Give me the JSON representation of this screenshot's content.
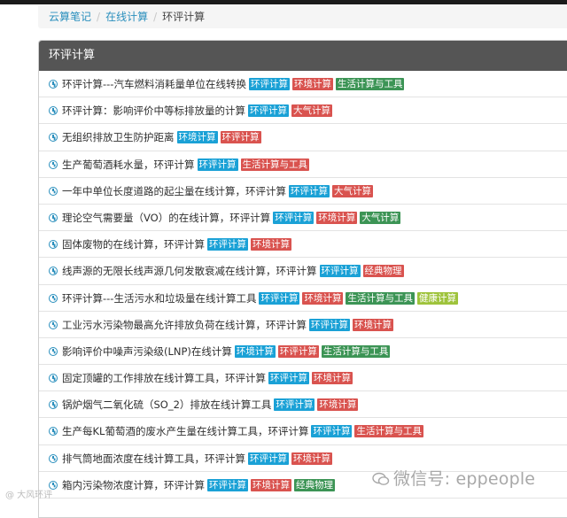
{
  "breadcrumb": {
    "items": [
      "云算笔记",
      "在线计算",
      "环评计算"
    ]
  },
  "panel": {
    "title": "环评计算"
  },
  "tag_colors": {
    "blue": "#1aa1d6",
    "red": "#d9534f",
    "green": "#3c9455",
    "lime": "#9ec33b"
  },
  "items": [
    {
      "title": "环评计算---汽车燃料消耗量单位在线转换",
      "tags": [
        {
          "label": "环评计算",
          "color": "blue"
        },
        {
          "label": "环境计算",
          "color": "red"
        },
        {
          "label": "生活计算与工具",
          "color": "green"
        }
      ]
    },
    {
      "title": "环评计算：影响评价中等标排放量的计算",
      "tags": [
        {
          "label": "环评计算",
          "color": "blue"
        },
        {
          "label": "大气计算",
          "color": "red"
        }
      ]
    },
    {
      "title": "无组织排放卫生防护距离",
      "tags": [
        {
          "label": "环境计算",
          "color": "blue"
        },
        {
          "label": "环评计算",
          "color": "red"
        }
      ]
    },
    {
      "title": "生产葡萄酒耗水量，环评计算",
      "tags": [
        {
          "label": "环评计算",
          "color": "blue"
        },
        {
          "label": "生活计算与工具",
          "color": "red"
        }
      ]
    },
    {
      "title": "一年中单位长度道路的起尘量在线计算，环评计算",
      "tags": [
        {
          "label": "环评计算",
          "color": "blue"
        },
        {
          "label": "大气计算",
          "color": "red"
        }
      ]
    },
    {
      "title": "理论空气需要量（VO）的在线计算，环评计算",
      "tags": [
        {
          "label": "环评计算",
          "color": "blue"
        },
        {
          "label": "环境计算",
          "color": "red"
        },
        {
          "label": "大气计算",
          "color": "green"
        }
      ]
    },
    {
      "title": "固体废物的在线计算，环评计算",
      "tags": [
        {
          "label": "环评计算",
          "color": "blue"
        },
        {
          "label": "环境计算",
          "color": "red"
        }
      ]
    },
    {
      "title": "线声源的无限长线声源几何发散衰减在线计算，环评计算",
      "tags": [
        {
          "label": "环评计算",
          "color": "blue"
        },
        {
          "label": "经典物理",
          "color": "red"
        }
      ]
    },
    {
      "title": "环评计算---生活污水和垃圾量在线计算工具",
      "tags": [
        {
          "label": "环评计算",
          "color": "blue"
        },
        {
          "label": "环境计算",
          "color": "red"
        },
        {
          "label": "生活计算与工具",
          "color": "green"
        },
        {
          "label": "健康计算",
          "color": "lime"
        }
      ]
    },
    {
      "title": "工业污水污染物最高允许排放负荷在线计算，环评计算",
      "tags": [
        {
          "label": "环评计算",
          "color": "blue"
        },
        {
          "label": "环境计算",
          "color": "red"
        }
      ]
    },
    {
      "title": "影响评价中噪声污染级(LNP)在线计算",
      "tags": [
        {
          "label": "环境计算",
          "color": "blue"
        },
        {
          "label": "环评计算",
          "color": "red"
        },
        {
          "label": "生活计算与工具",
          "color": "green"
        }
      ]
    },
    {
      "title": "固定顶罐的工作排放在线计算工具，环评计算",
      "tags": [
        {
          "label": "环评计算",
          "color": "blue"
        },
        {
          "label": "环境计算",
          "color": "red"
        }
      ]
    },
    {
      "title": "锅炉烟气二氧化硫（SO_2）排放在线计算工具",
      "tags": [
        {
          "label": "环评计算",
          "color": "blue"
        },
        {
          "label": "环境计算",
          "color": "red"
        }
      ]
    },
    {
      "title": "生产每KL葡萄酒的废水产生量在线计算工具，环评计算",
      "tags": [
        {
          "label": "环评计算",
          "color": "blue"
        },
        {
          "label": "生活计算与工具",
          "color": "red"
        }
      ]
    },
    {
      "title": "排气筒地面浓度在线计算工具，环评计算",
      "tags": [
        {
          "label": "环评计算",
          "color": "blue"
        },
        {
          "label": "环境计算",
          "color": "red"
        }
      ]
    },
    {
      "title": "箱内污染物浓度计算，环评计算",
      "tags": [
        {
          "label": "环评计算",
          "color": "blue"
        },
        {
          "label": "环境计算",
          "color": "red"
        },
        {
          "label": "经典物理",
          "color": "green"
        }
      ]
    }
  ],
  "watermark": {
    "text": "微信号: eppeople",
    "corner_text": "@ 大风环评"
  }
}
